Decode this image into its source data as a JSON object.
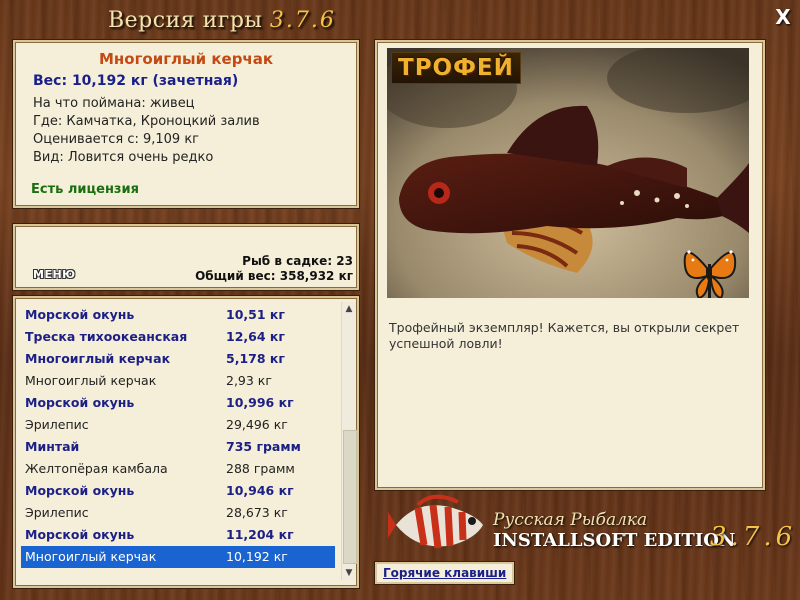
{
  "window": {
    "title_prefix": "Версия игры",
    "title_version": "3.7.6",
    "close_label": "X"
  },
  "catch_info": {
    "fish_name": "Многоиглый керчак",
    "weight_line": "Вес: 10,192 кг (зачетная)",
    "bait_line": "На что поймана: живец",
    "place_line": "Где: Камчатка, Кроноцкий залив",
    "valued_line": "Оценивается с: 9,109 кг",
    "kind_line": "Вид: Ловится очень редко",
    "license_line": "Есть лицензия"
  },
  "status": {
    "menu_label": "МЕНЮ",
    "fish_count_line": "Рыб в садке: 23",
    "total_weight_line": "Общий вес: 358,932 кг"
  },
  "catch_list": [
    {
      "name": "Морской окунь",
      "weight": "10,51 кг",
      "style": "bold"
    },
    {
      "name": "Треска тихоокеанская",
      "weight": "12,64 кг",
      "style": "bold"
    },
    {
      "name": "Многоиглый керчак",
      "weight": "5,178 кг",
      "style": "bold"
    },
    {
      "name": "Многоиглый керчак",
      "weight": "2,93 кг",
      "style": "norm"
    },
    {
      "name": "Морской окунь",
      "weight": "10,996 кг",
      "style": "bold"
    },
    {
      "name": "Эрилепис",
      "weight": "29,496 кг",
      "style": "norm"
    },
    {
      "name": "Минтай",
      "weight": "735 грамм",
      "style": "bold"
    },
    {
      "name": "Желтопёрая камбала",
      "weight": "288 грамм",
      "style": "norm"
    },
    {
      "name": "Морской окунь",
      "weight": "10,946 кг",
      "style": "bold"
    },
    {
      "name": "Эрилепис",
      "weight": "28,673 кг",
      "style": "norm"
    },
    {
      "name": "Морской окунь",
      "weight": "11,204 кг",
      "style": "bold"
    },
    {
      "name": "Многоиглый керчак",
      "weight": "10,192 кг",
      "style": "sel"
    }
  ],
  "photo": {
    "badge": "ТРОФЕЙ",
    "caption": "Трофейный экземпляр! Кажется, вы открыли секрет успешной ловли!"
  },
  "branding": {
    "line1": "Русская Рыбалка",
    "line2": "INSTALLSOFT EDITION",
    "version": "3.7.6"
  },
  "hotkeys_label": "Горячие клавиши",
  "colors": {
    "fish_name": "#c34a12",
    "weight_blue": "#1a1f8a",
    "license_green": "#1a6e12",
    "selection": "#1a64d2",
    "panel_bg": "#f5efd9",
    "badge_text": "#f0b22e"
  }
}
